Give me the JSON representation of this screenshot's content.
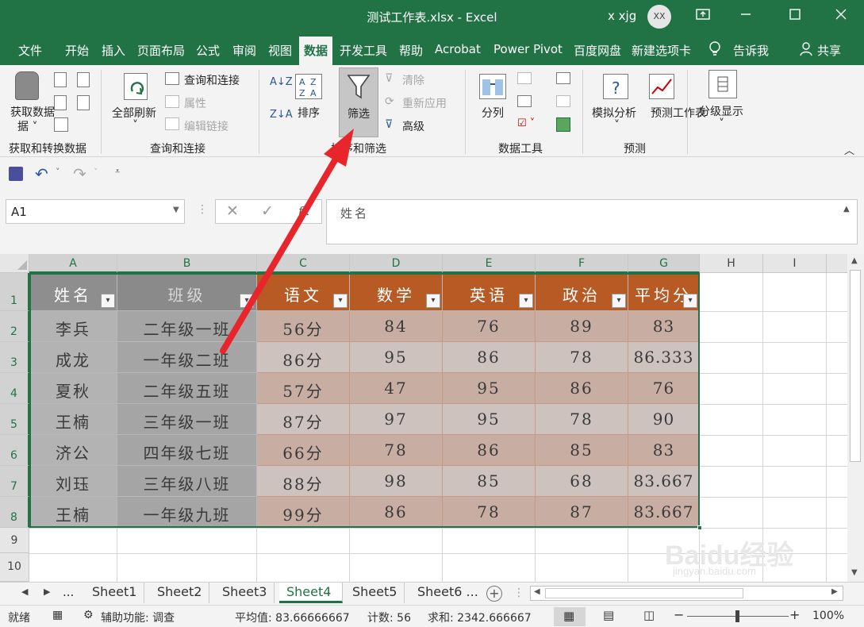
{
  "window": {
    "title": "测试工作表.xlsx - Excel",
    "user": "x xjg",
    "avatar_initials": "XX"
  },
  "menu_tabs": [
    "文件",
    "开始",
    "插入",
    "页面布局",
    "公式",
    "审阅",
    "视图",
    "数据",
    "开发工具",
    "帮助",
    "Acrobat",
    "Power Pivot",
    "百度网盘",
    "新建选项卡"
  ],
  "tell_me": "告诉我",
  "share": "共享",
  "ribbon": {
    "get_data": "获取数据",
    "group_get_transform": "获取和转换数据",
    "refresh_all": "全部刷新",
    "queries_connections": "查询和连接",
    "properties": "属性",
    "edit_links": "编辑链接",
    "group_queries": "查询和连接",
    "sort": "排序",
    "filter": "筛选",
    "clear": "清除",
    "reapply": "重新应用",
    "advanced": "高级",
    "group_sort_filter": "排序和筛选",
    "text_to_columns": "分列",
    "group_data_tools": "数据工具",
    "whatif": "模拟分析",
    "forecast_sheet": "预测工作表",
    "group_forecast": "预测",
    "outline": "分级显示"
  },
  "name_box": "A1",
  "formula": "姓名",
  "columns": [
    "A",
    "B",
    "C",
    "D",
    "E",
    "F",
    "G",
    "H",
    "I"
  ],
  "rows": [
    "1",
    "2",
    "3",
    "4",
    "5",
    "6",
    "7",
    "8",
    "9",
    "10"
  ],
  "table": {
    "headers": [
      "姓名",
      "班级",
      "语文",
      "数学",
      "英语",
      "政治",
      "平均分"
    ],
    "rows": [
      [
        "李兵",
        "二年级一班",
        "56分",
        "84",
        "76",
        "89",
        "83"
      ],
      [
        "成龙",
        "一年级二班",
        "86分",
        "95",
        "86",
        "78",
        "86.333"
      ],
      [
        "夏秋",
        "二年级五班",
        "57分",
        "47",
        "95",
        "86",
        "76"
      ],
      [
        "王楠",
        "三年级一班",
        "87分",
        "97",
        "95",
        "78",
        "90"
      ],
      [
        "济公",
        "四年级七班",
        "66分",
        "78",
        "86",
        "85",
        "83"
      ],
      [
        "刘珏",
        "三年级八班",
        "88分",
        "98",
        "85",
        "68",
        "83.667"
      ],
      [
        "王楠",
        "一年级九班",
        "99分",
        "86",
        "78",
        "87",
        "83.667"
      ]
    ]
  },
  "sheets": [
    "Sheet1",
    "Sheet2",
    "Sheet3",
    "Sheet4",
    "Sheet5",
    "Sheet6 ..."
  ],
  "active_sheet": "Sheet4",
  "sheet_ellipsis": "...",
  "status": {
    "ready": "就绪",
    "accessibility": "辅助功能: 调查",
    "average": "平均值: 83.66666667",
    "count": "计数: 56",
    "sum": "求和: 2342.666667",
    "zoom": "100%"
  },
  "watermark": "Baidu经验 jingyan.baidu.com",
  "colors": {
    "excel_green": "#217346",
    "header_orange": "#b95a23",
    "header_gray": "#8a8a8a",
    "cell_brown": "#c7aca1",
    "cell_gray": "#b4b4b4",
    "arrow_red": "#e8252b"
  }
}
